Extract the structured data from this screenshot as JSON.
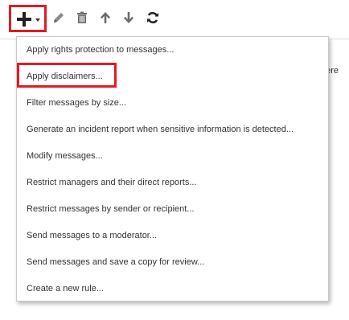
{
  "toolbar": {
    "buttons": [
      {
        "icon": "plus-icon",
        "has_dropdown": true,
        "highlighted": true
      },
      {
        "icon": "pencil-icon"
      },
      {
        "icon": "trash-icon"
      },
      {
        "icon": "arrow-up-icon"
      },
      {
        "icon": "arrow-down-icon"
      },
      {
        "icon": "refresh-icon"
      }
    ]
  },
  "background": {
    "partial_text": "here"
  },
  "menu": {
    "items": [
      {
        "label": "Apply rights protection to messages..."
      },
      {
        "label": "Apply disclaimers...",
        "highlighted": true
      },
      {
        "label": "Filter messages by size..."
      },
      {
        "label": "Generate an incident report when sensitive information is detected..."
      },
      {
        "label": "Modify messages..."
      },
      {
        "label": "Restrict managers and their direct reports..."
      },
      {
        "label": "Restrict messages by sender or recipient..."
      },
      {
        "label": "Send messages to a moderator..."
      },
      {
        "label": "Send messages and save a copy for review..."
      },
      {
        "label": "Create a new rule..."
      }
    ]
  },
  "colors": {
    "highlight": "#e01b24",
    "text": "#333333",
    "icon": "#6d6d6d"
  }
}
